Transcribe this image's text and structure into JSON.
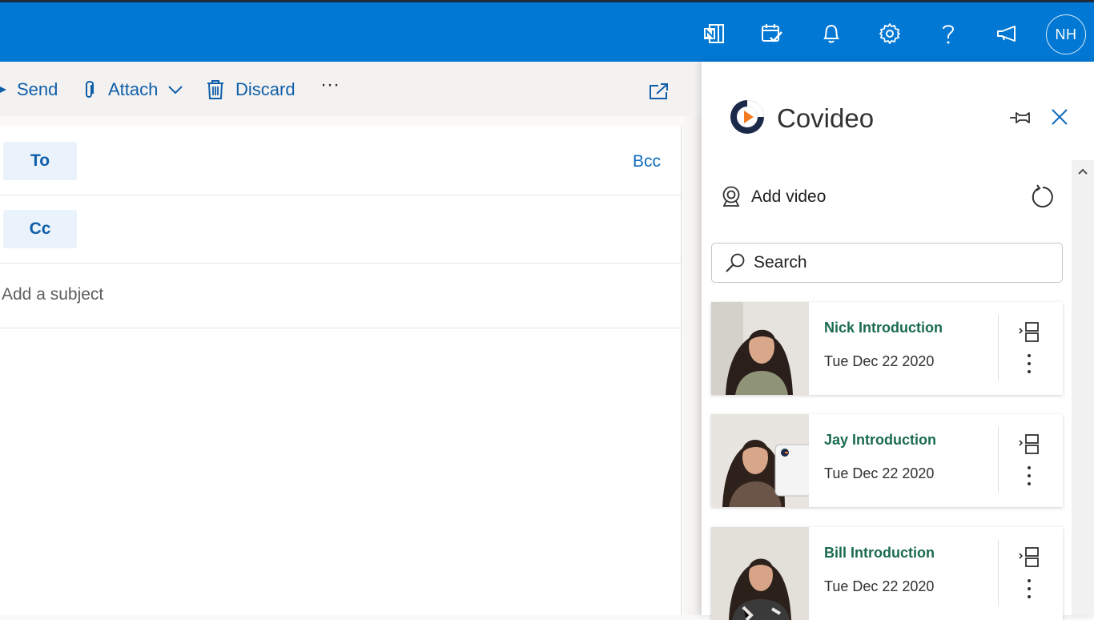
{
  "topbar": {
    "icons": [
      "onenote-icon",
      "calendar-check-icon",
      "bell-icon",
      "gear-icon",
      "help-icon",
      "megaphone-icon"
    ],
    "avatar_initials": "NH"
  },
  "toolbar": {
    "send_label": "Send",
    "attach_label": "Attach",
    "discard_label": "Discard",
    "more_label": "···"
  },
  "compose": {
    "to_label": "To",
    "cc_label": "Cc",
    "bcc_label": "Bcc",
    "subject_placeholder": "Add a subject"
  },
  "panel": {
    "title": "Covideo",
    "add_video_label": "Add video",
    "search_placeholder": "Search",
    "videos": [
      {
        "title": "Nick Introduction",
        "date": "Tue Dec 22 2020"
      },
      {
        "title": "Jay Introduction",
        "date": "Tue Dec 22 2020"
      },
      {
        "title": "Bill Introduction",
        "date": "Tue Dec 22 2020"
      }
    ]
  },
  "colors": {
    "topbar": "#0078d4",
    "accent_text": "#0f5ea8",
    "video_title": "#1a6b4f"
  }
}
